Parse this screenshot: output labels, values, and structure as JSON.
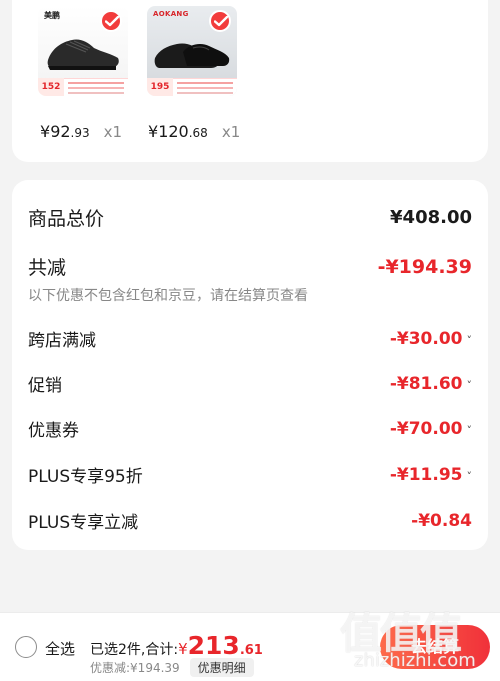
{
  "products": [
    {
      "brand": "美鹏",
      "badge_number": "152",
      "price_symbol": "¥",
      "price_int": "92",
      "price_dec": ".93",
      "qty": "x1"
    },
    {
      "brand": "AOKANG",
      "badge_number": "195",
      "price_symbol": "¥",
      "price_int": "120",
      "price_dec": ".68",
      "qty": "x1"
    }
  ],
  "summary": {
    "goods_total_label": "商品总价",
    "goods_total_value": "¥408.00",
    "total_reduce_label": "共减",
    "total_reduce_value": "-¥194.39",
    "note": "以下优惠不包含红包和京豆，请在结算页查看",
    "items": [
      {
        "label": "跨店满减",
        "value": "-¥30.00",
        "chevron": "˅"
      },
      {
        "label": "促销",
        "value": "-¥81.60",
        "chevron": "˅"
      },
      {
        "label": "优惠券",
        "value": "-¥70.00",
        "chevron": "˅"
      },
      {
        "label": "PLUS专享95折",
        "value": "-¥11.95",
        "chevron": "˅"
      },
      {
        "label": "PLUS专享立减",
        "value": "-¥0.84",
        "chevron": ""
      }
    ]
  },
  "bottom": {
    "select_all": "全选",
    "selected_text": "已选2件,合计:",
    "total_symbol": "¥",
    "total_int": "213",
    "total_dec": ".61",
    "discount_text": "优惠减:¥194.39",
    "detail_button": "优惠明细",
    "checkout_button": "去结算"
  },
  "watermark": {
    "site_text": "值值值",
    "url": "zhizhizhi.com"
  },
  "colors": {
    "accent_red": "#e8262b",
    "background": "#f3f3f3"
  }
}
